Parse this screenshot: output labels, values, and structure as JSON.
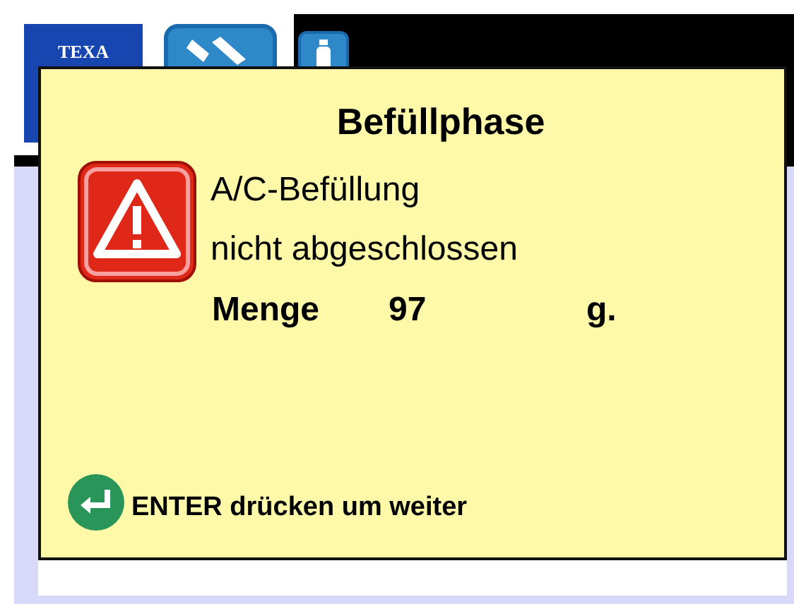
{
  "logo": {
    "text": "TEXA"
  },
  "dialog": {
    "title": "Befüllphase",
    "message_lines": [
      "A/C-Befüllung",
      "nicht abgeschlossen"
    ],
    "quantity": {
      "label": "Menge",
      "value": "97",
      "unit": "g."
    },
    "hint": "ENTER drücken um weiter"
  }
}
